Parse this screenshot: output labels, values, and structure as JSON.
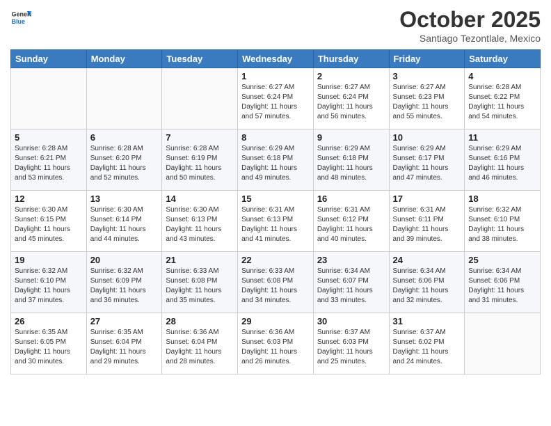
{
  "header": {
    "logo_general": "General",
    "logo_blue": "Blue",
    "month": "October 2025",
    "location": "Santiago Tezontlale, Mexico"
  },
  "days_of_week": [
    "Sunday",
    "Monday",
    "Tuesday",
    "Wednesday",
    "Thursday",
    "Friday",
    "Saturday"
  ],
  "weeks": [
    [
      {
        "day": "",
        "info": ""
      },
      {
        "day": "",
        "info": ""
      },
      {
        "day": "",
        "info": ""
      },
      {
        "day": "1",
        "info": "Sunrise: 6:27 AM\nSunset: 6:24 PM\nDaylight: 11 hours and 57 minutes."
      },
      {
        "day": "2",
        "info": "Sunrise: 6:27 AM\nSunset: 6:24 PM\nDaylight: 11 hours and 56 minutes."
      },
      {
        "day": "3",
        "info": "Sunrise: 6:27 AM\nSunset: 6:23 PM\nDaylight: 11 hours and 55 minutes."
      },
      {
        "day": "4",
        "info": "Sunrise: 6:28 AM\nSunset: 6:22 PM\nDaylight: 11 hours and 54 minutes."
      }
    ],
    [
      {
        "day": "5",
        "info": "Sunrise: 6:28 AM\nSunset: 6:21 PM\nDaylight: 11 hours and 53 minutes."
      },
      {
        "day": "6",
        "info": "Sunrise: 6:28 AM\nSunset: 6:20 PM\nDaylight: 11 hours and 52 minutes."
      },
      {
        "day": "7",
        "info": "Sunrise: 6:28 AM\nSunset: 6:19 PM\nDaylight: 11 hours and 50 minutes."
      },
      {
        "day": "8",
        "info": "Sunrise: 6:29 AM\nSunset: 6:18 PM\nDaylight: 11 hours and 49 minutes."
      },
      {
        "day": "9",
        "info": "Sunrise: 6:29 AM\nSunset: 6:18 PM\nDaylight: 11 hours and 48 minutes."
      },
      {
        "day": "10",
        "info": "Sunrise: 6:29 AM\nSunset: 6:17 PM\nDaylight: 11 hours and 47 minutes."
      },
      {
        "day": "11",
        "info": "Sunrise: 6:29 AM\nSunset: 6:16 PM\nDaylight: 11 hours and 46 minutes."
      }
    ],
    [
      {
        "day": "12",
        "info": "Sunrise: 6:30 AM\nSunset: 6:15 PM\nDaylight: 11 hours and 45 minutes."
      },
      {
        "day": "13",
        "info": "Sunrise: 6:30 AM\nSunset: 6:14 PM\nDaylight: 11 hours and 44 minutes."
      },
      {
        "day": "14",
        "info": "Sunrise: 6:30 AM\nSunset: 6:13 PM\nDaylight: 11 hours and 43 minutes."
      },
      {
        "day": "15",
        "info": "Sunrise: 6:31 AM\nSunset: 6:13 PM\nDaylight: 11 hours and 41 minutes."
      },
      {
        "day": "16",
        "info": "Sunrise: 6:31 AM\nSunset: 6:12 PM\nDaylight: 11 hours and 40 minutes."
      },
      {
        "day": "17",
        "info": "Sunrise: 6:31 AM\nSunset: 6:11 PM\nDaylight: 11 hours and 39 minutes."
      },
      {
        "day": "18",
        "info": "Sunrise: 6:32 AM\nSunset: 6:10 PM\nDaylight: 11 hours and 38 minutes."
      }
    ],
    [
      {
        "day": "19",
        "info": "Sunrise: 6:32 AM\nSunset: 6:10 PM\nDaylight: 11 hours and 37 minutes."
      },
      {
        "day": "20",
        "info": "Sunrise: 6:32 AM\nSunset: 6:09 PM\nDaylight: 11 hours and 36 minutes."
      },
      {
        "day": "21",
        "info": "Sunrise: 6:33 AM\nSunset: 6:08 PM\nDaylight: 11 hours and 35 minutes."
      },
      {
        "day": "22",
        "info": "Sunrise: 6:33 AM\nSunset: 6:08 PM\nDaylight: 11 hours and 34 minutes."
      },
      {
        "day": "23",
        "info": "Sunrise: 6:34 AM\nSunset: 6:07 PM\nDaylight: 11 hours and 33 minutes."
      },
      {
        "day": "24",
        "info": "Sunrise: 6:34 AM\nSunset: 6:06 PM\nDaylight: 11 hours and 32 minutes."
      },
      {
        "day": "25",
        "info": "Sunrise: 6:34 AM\nSunset: 6:06 PM\nDaylight: 11 hours and 31 minutes."
      }
    ],
    [
      {
        "day": "26",
        "info": "Sunrise: 6:35 AM\nSunset: 6:05 PM\nDaylight: 11 hours and 30 minutes."
      },
      {
        "day": "27",
        "info": "Sunrise: 6:35 AM\nSunset: 6:04 PM\nDaylight: 11 hours and 29 minutes."
      },
      {
        "day": "28",
        "info": "Sunrise: 6:36 AM\nSunset: 6:04 PM\nDaylight: 11 hours and 28 minutes."
      },
      {
        "day": "29",
        "info": "Sunrise: 6:36 AM\nSunset: 6:03 PM\nDaylight: 11 hours and 26 minutes."
      },
      {
        "day": "30",
        "info": "Sunrise: 6:37 AM\nSunset: 6:03 PM\nDaylight: 11 hours and 25 minutes."
      },
      {
        "day": "31",
        "info": "Sunrise: 6:37 AM\nSunset: 6:02 PM\nDaylight: 11 hours and 24 minutes."
      },
      {
        "day": "",
        "info": ""
      }
    ]
  ]
}
